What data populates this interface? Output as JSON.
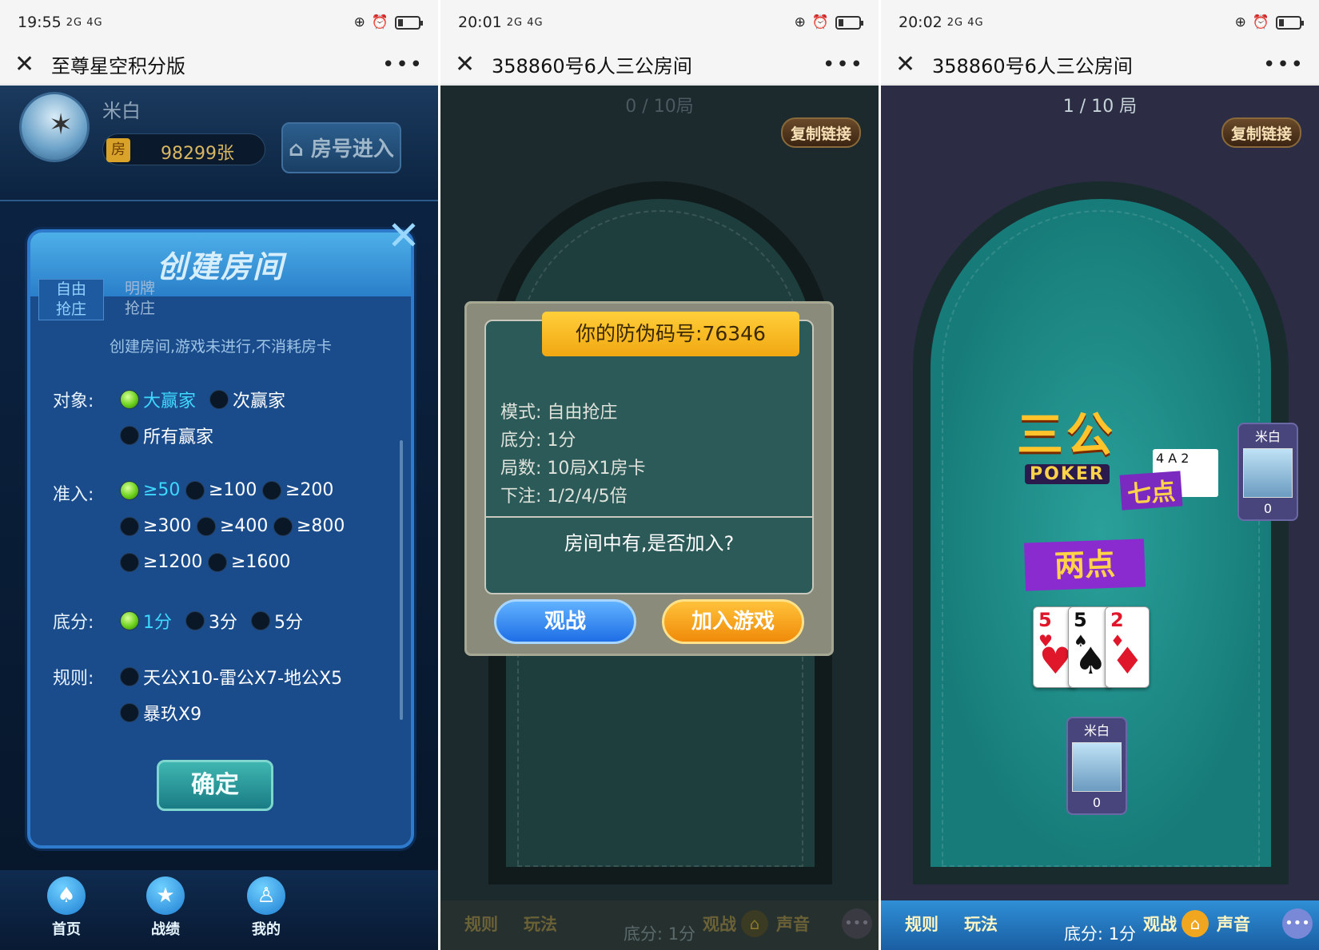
{
  "panel1": {
    "status": {
      "time": "19:55",
      "signal": "2G 4G"
    },
    "title": "至尊星空积分版",
    "user": {
      "name": "米白",
      "cards": "98299张",
      "card_icon": "房"
    },
    "join_room": "房号进入",
    "dialog": {
      "title": "创建房间",
      "tabs": [
        "自由\n抢庄",
        "明牌\n抢庄"
      ],
      "tip": "创建房间,游戏未进行,不消耗房卡",
      "rows": [
        {
          "label": "对象:",
          "options": [
            "大赢家",
            "次赢家",
            "所有赢家"
          ],
          "selected": "大赢家"
        },
        {
          "label": "准入:",
          "options": [
            "≥50",
            "≥100",
            "≥200",
            "≥300",
            "≥400",
            "≥800",
            "≥1200",
            "≥1600"
          ],
          "selected": "≥50"
        },
        {
          "label": "底分:",
          "options": [
            "1分",
            "3分",
            "5分"
          ],
          "selected": "1分"
        },
        {
          "label": "规则:",
          "options": [
            "天公X10-雷公X7-地公X5",
            "暴玖X9"
          ],
          "selected": ""
        }
      ],
      "confirm": "确定"
    },
    "nav": [
      "首页",
      "战绩",
      "我的"
    ]
  },
  "panel2": {
    "status": {
      "time": "20:01",
      "signal": "2G 4G"
    },
    "title": "358860号6人三公房间",
    "round": "0 / 10局",
    "copy_link": "复制链接",
    "modal": {
      "banner": "你的防伪码号:76346",
      "lines": [
        "模式:  自由抢庄",
        "底分:  1分",
        "局数:  10局X1房卡",
        "下注: 1/2/4/5倍"
      ],
      "question": "房间中有,是否加入?",
      "watch": "观战",
      "join": "加入游戏"
    },
    "bottom": {
      "rules": "规则",
      "play": "玩法",
      "score": "底分:  1分",
      "watch": "观战",
      "sound": "声音"
    }
  },
  "panel3": {
    "status": {
      "time": "20:02",
      "signal": "2G 4G"
    },
    "title": "358860号6人三公房间",
    "round": "1 / 10 局",
    "copy_link": "复制链接",
    "logo": {
      "name": "三公",
      "sub": "POKER"
    },
    "opponent": {
      "name": "米白",
      "score": "0",
      "result": "七点",
      "cards": "4  A  2"
    },
    "self": {
      "name": "米白",
      "score": "0",
      "result": "两点"
    },
    "hand": [
      {
        "rank": "5",
        "suit": "♥",
        "color": "red"
      },
      {
        "rank": "5",
        "suit": "♠",
        "color": "black"
      },
      {
        "rank": "2",
        "suit": "♦",
        "color": "red"
      }
    ],
    "bottom": {
      "rules": "规则",
      "play": "玩法",
      "score": "底分:  1分",
      "watch": "观战",
      "sound": "声音"
    }
  }
}
